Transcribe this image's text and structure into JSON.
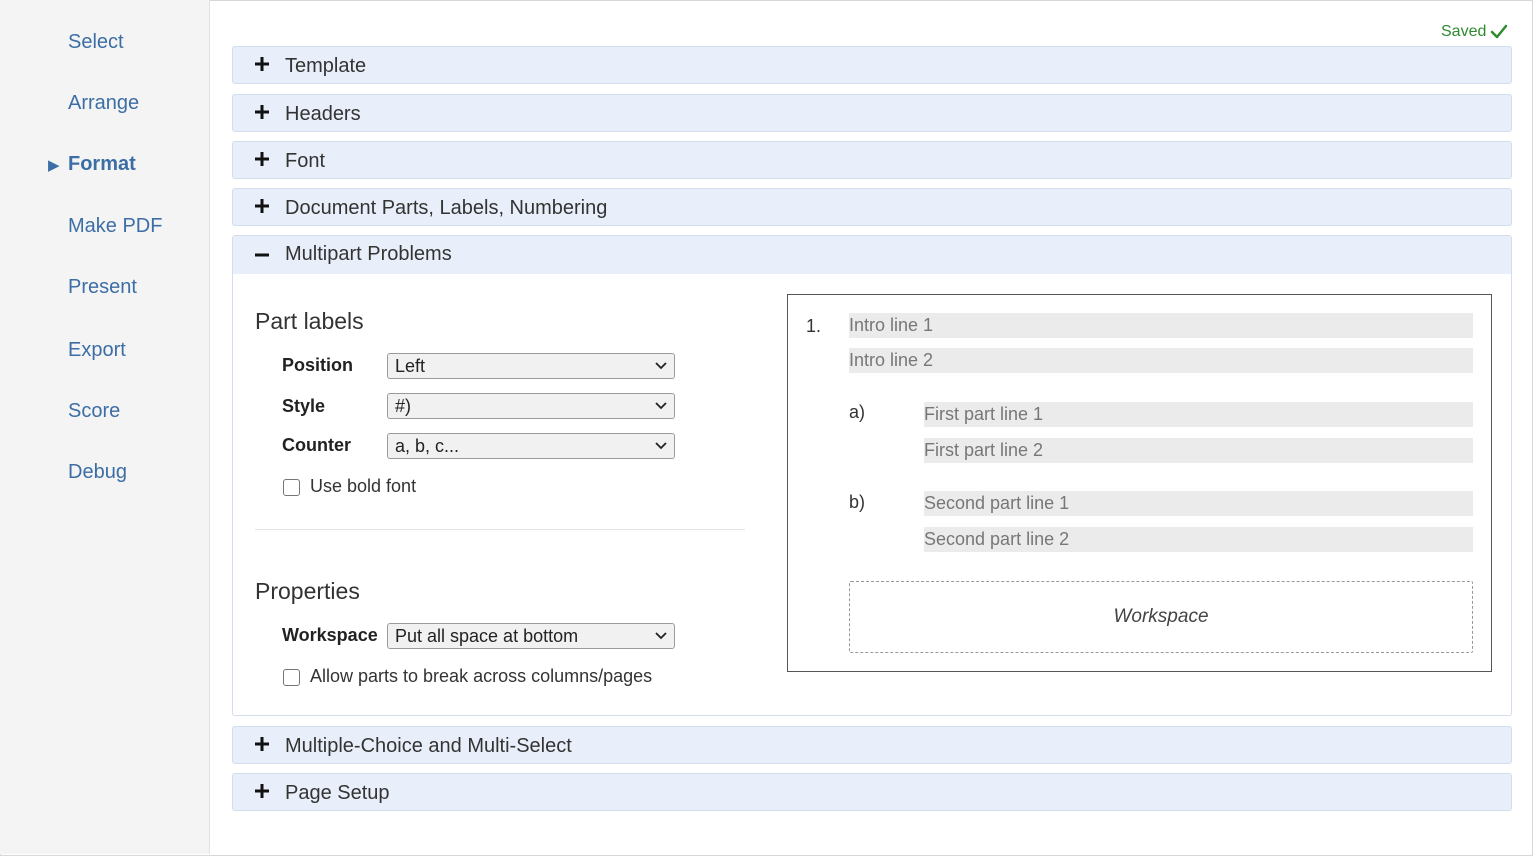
{
  "sidebar": {
    "items": [
      {
        "label": "Select"
      },
      {
        "label": "Arrange"
      },
      {
        "label": "Format",
        "active": true
      },
      {
        "label": "Make PDF"
      },
      {
        "label": "Present"
      },
      {
        "label": "Export"
      },
      {
        "label": "Score"
      },
      {
        "label": "Debug"
      }
    ],
    "active_marker": "▶"
  },
  "status": {
    "saved_label": "Saved"
  },
  "panels": {
    "template": {
      "title": "Template",
      "state": "collapsed"
    },
    "headers": {
      "title": "Headers",
      "state": "collapsed"
    },
    "font": {
      "title": "Font",
      "state": "collapsed"
    },
    "document_parts": {
      "title": "Document Parts, Labels, Numbering",
      "state": "collapsed"
    },
    "multipart": {
      "title": "Multipart Problems",
      "state": "expanded"
    },
    "multiple_choice": {
      "title": "Multiple-Choice and Multi-Select",
      "state": "collapsed"
    },
    "page_setup": {
      "title": "Page Setup",
      "state": "collapsed"
    }
  },
  "multipart": {
    "part_labels": {
      "heading": "Part labels",
      "position": {
        "label": "Position",
        "value": "Left"
      },
      "style": {
        "label": "Style",
        "value": "#)"
      },
      "counter": {
        "label": "Counter",
        "value": "a, b, c..."
      },
      "bold": {
        "label": "Use bold font",
        "checked": false
      }
    },
    "properties": {
      "heading": "Properties",
      "workspace": {
        "label": "Workspace",
        "value": "Put all space at bottom"
      },
      "break": {
        "label": "Allow parts to break across columns/pages",
        "checked": false
      }
    },
    "preview": {
      "number": "1.",
      "intro_lines": [
        "Intro line 1",
        "Intro line 2"
      ],
      "parts": [
        {
          "label": "a)",
          "lines": [
            "First part line 1",
            "First part line 2"
          ]
        },
        {
          "label": "b)",
          "lines": [
            "Second part line 1",
            "Second part line 2"
          ]
        }
      ],
      "workspace_label": "Workspace"
    }
  },
  "colors": {
    "accent": "#3c6ea5",
    "panel_bg": "#e9effa",
    "saved": "#2e8b2e"
  },
  "icons": {
    "collapsed": "plus-icon",
    "expanded": "minus-icon",
    "saved": "checkmark-icon",
    "select": "chevron-down-icon"
  }
}
